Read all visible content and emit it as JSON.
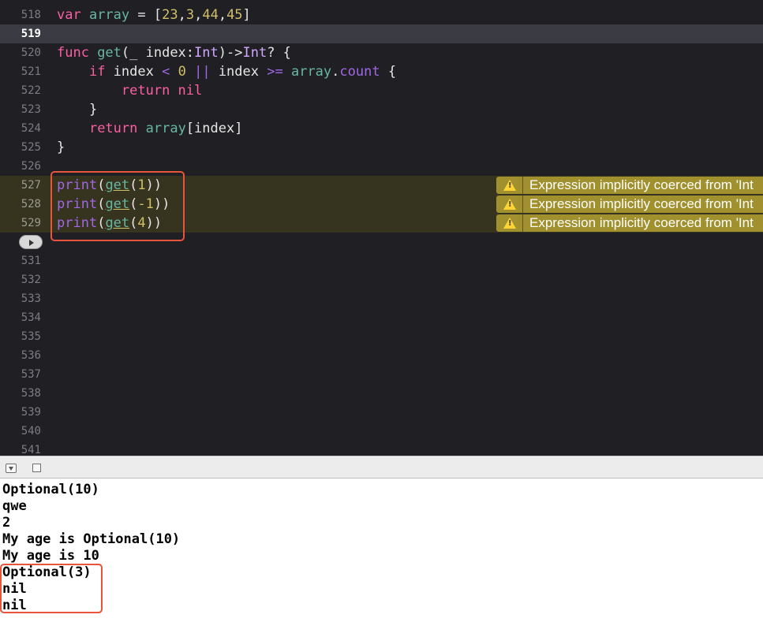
{
  "editor": {
    "lines": [
      {
        "num": "518",
        "tokens": [
          {
            "t": "var ",
            "c": "kw"
          },
          {
            "t": "array",
            "c": "fn"
          },
          {
            "t": " = [",
            "c": "plain"
          },
          {
            "t": "23",
            "c": "num"
          },
          {
            "t": ",",
            "c": "plain"
          },
          {
            "t": "3",
            "c": "num"
          },
          {
            "t": ",",
            "c": "plain"
          },
          {
            "t": "44",
            "c": "num"
          },
          {
            "t": ",",
            "c": "plain"
          },
          {
            "t": "45",
            "c": "num"
          },
          {
            "t": "]",
            "c": "plain"
          }
        ]
      },
      {
        "num": "519",
        "tokens": []
      },
      {
        "num": "520",
        "tokens": [
          {
            "t": "func ",
            "c": "kw"
          },
          {
            "t": "get",
            "c": "fn"
          },
          {
            "t": "(_ index:",
            "c": "plain"
          },
          {
            "t": "Int",
            "c": "ty"
          },
          {
            "t": ")->",
            "c": "plain"
          },
          {
            "t": "Int",
            "c": "ty"
          },
          {
            "t": "? {",
            "c": "plain"
          }
        ]
      },
      {
        "num": "521",
        "tokens": [
          {
            "t": "    ",
            "c": "plain"
          },
          {
            "t": "if",
            "c": "kw"
          },
          {
            "t": " index ",
            "c": "plain"
          },
          {
            "t": "<",
            "c": "prop"
          },
          {
            "t": " ",
            "c": "plain"
          },
          {
            "t": "0",
            "c": "num"
          },
          {
            "t": " ",
            "c": "plain"
          },
          {
            "t": "||",
            "c": "prop"
          },
          {
            "t": " index ",
            "c": "plain"
          },
          {
            "t": ">=",
            "c": "prop"
          },
          {
            "t": " ",
            "c": "plain"
          },
          {
            "t": "array",
            "c": "fn"
          },
          {
            "t": ".",
            "c": "plain"
          },
          {
            "t": "count",
            "c": "prop"
          },
          {
            "t": " {",
            "c": "plain"
          }
        ]
      },
      {
        "num": "522",
        "tokens": [
          {
            "t": "        ",
            "c": "plain"
          },
          {
            "t": "return nil",
            "c": "kw"
          }
        ]
      },
      {
        "num": "523",
        "tokens": [
          {
            "t": "    }",
            "c": "plain"
          }
        ]
      },
      {
        "num": "524",
        "tokens": [
          {
            "t": "    ",
            "c": "plain"
          },
          {
            "t": "return",
            "c": "kw"
          },
          {
            "t": " ",
            "c": "plain"
          },
          {
            "t": "array",
            "c": "fn"
          },
          {
            "t": "[index]",
            "c": "plain"
          }
        ]
      },
      {
        "num": "525",
        "tokens": [
          {
            "t": "}",
            "c": "plain"
          }
        ]
      },
      {
        "num": "526",
        "tokens": []
      },
      {
        "num": "527",
        "tokens": [
          {
            "t": "print",
            "c": "call"
          },
          {
            "t": "(",
            "c": "plain"
          },
          {
            "t": "get",
            "c": "fn ul"
          },
          {
            "t": "(",
            "c": "plain"
          },
          {
            "t": "1",
            "c": "num"
          },
          {
            "t": "))",
            "c": "plain"
          }
        ]
      },
      {
        "num": "528",
        "tokens": [
          {
            "t": "print",
            "c": "call"
          },
          {
            "t": "(",
            "c": "plain"
          },
          {
            "t": "get",
            "c": "fn ul"
          },
          {
            "t": "(",
            "c": "plain"
          },
          {
            "t": "-1",
            "c": "num"
          },
          {
            "t": "))",
            "c": "plain"
          }
        ]
      },
      {
        "num": "529",
        "tokens": [
          {
            "t": "print",
            "c": "call"
          },
          {
            "t": "(",
            "c": "plain"
          },
          {
            "t": "get",
            "c": "fn ul"
          },
          {
            "t": "(",
            "c": "plain"
          },
          {
            "t": "4",
            "c": "num"
          },
          {
            "t": "))",
            "c": "plain"
          }
        ]
      },
      {
        "num": "",
        "tokens": []
      },
      {
        "num": "531",
        "tokens": []
      },
      {
        "num": "532",
        "tokens": []
      },
      {
        "num": "533",
        "tokens": []
      },
      {
        "num": "534",
        "tokens": []
      },
      {
        "num": "535",
        "tokens": []
      },
      {
        "num": "536",
        "tokens": []
      },
      {
        "num": "537",
        "tokens": []
      },
      {
        "num": "538",
        "tokens": []
      },
      {
        "num": "539",
        "tokens": []
      },
      {
        "num": "540",
        "tokens": []
      },
      {
        "num": "541",
        "tokens": []
      }
    ],
    "current_line": "519",
    "warning_lines": [
      "527",
      "528",
      "529"
    ],
    "warnings": [
      "Expression implicitly coerced from 'Int",
      "Expression implicitly coerced from 'Int",
      "Expression implicitly coerced from 'Int"
    ]
  },
  "console": {
    "output": [
      "Optional(10)",
      "qwe",
      "2",
      "My age is Optional(10)",
      "My age is 10",
      "Optional(3)",
      "nil",
      "nil"
    ]
  },
  "colors": {
    "editor_bg": "#1f1f24",
    "warning_banner": "#a1902e",
    "highlight_box": "#e8553a"
  }
}
